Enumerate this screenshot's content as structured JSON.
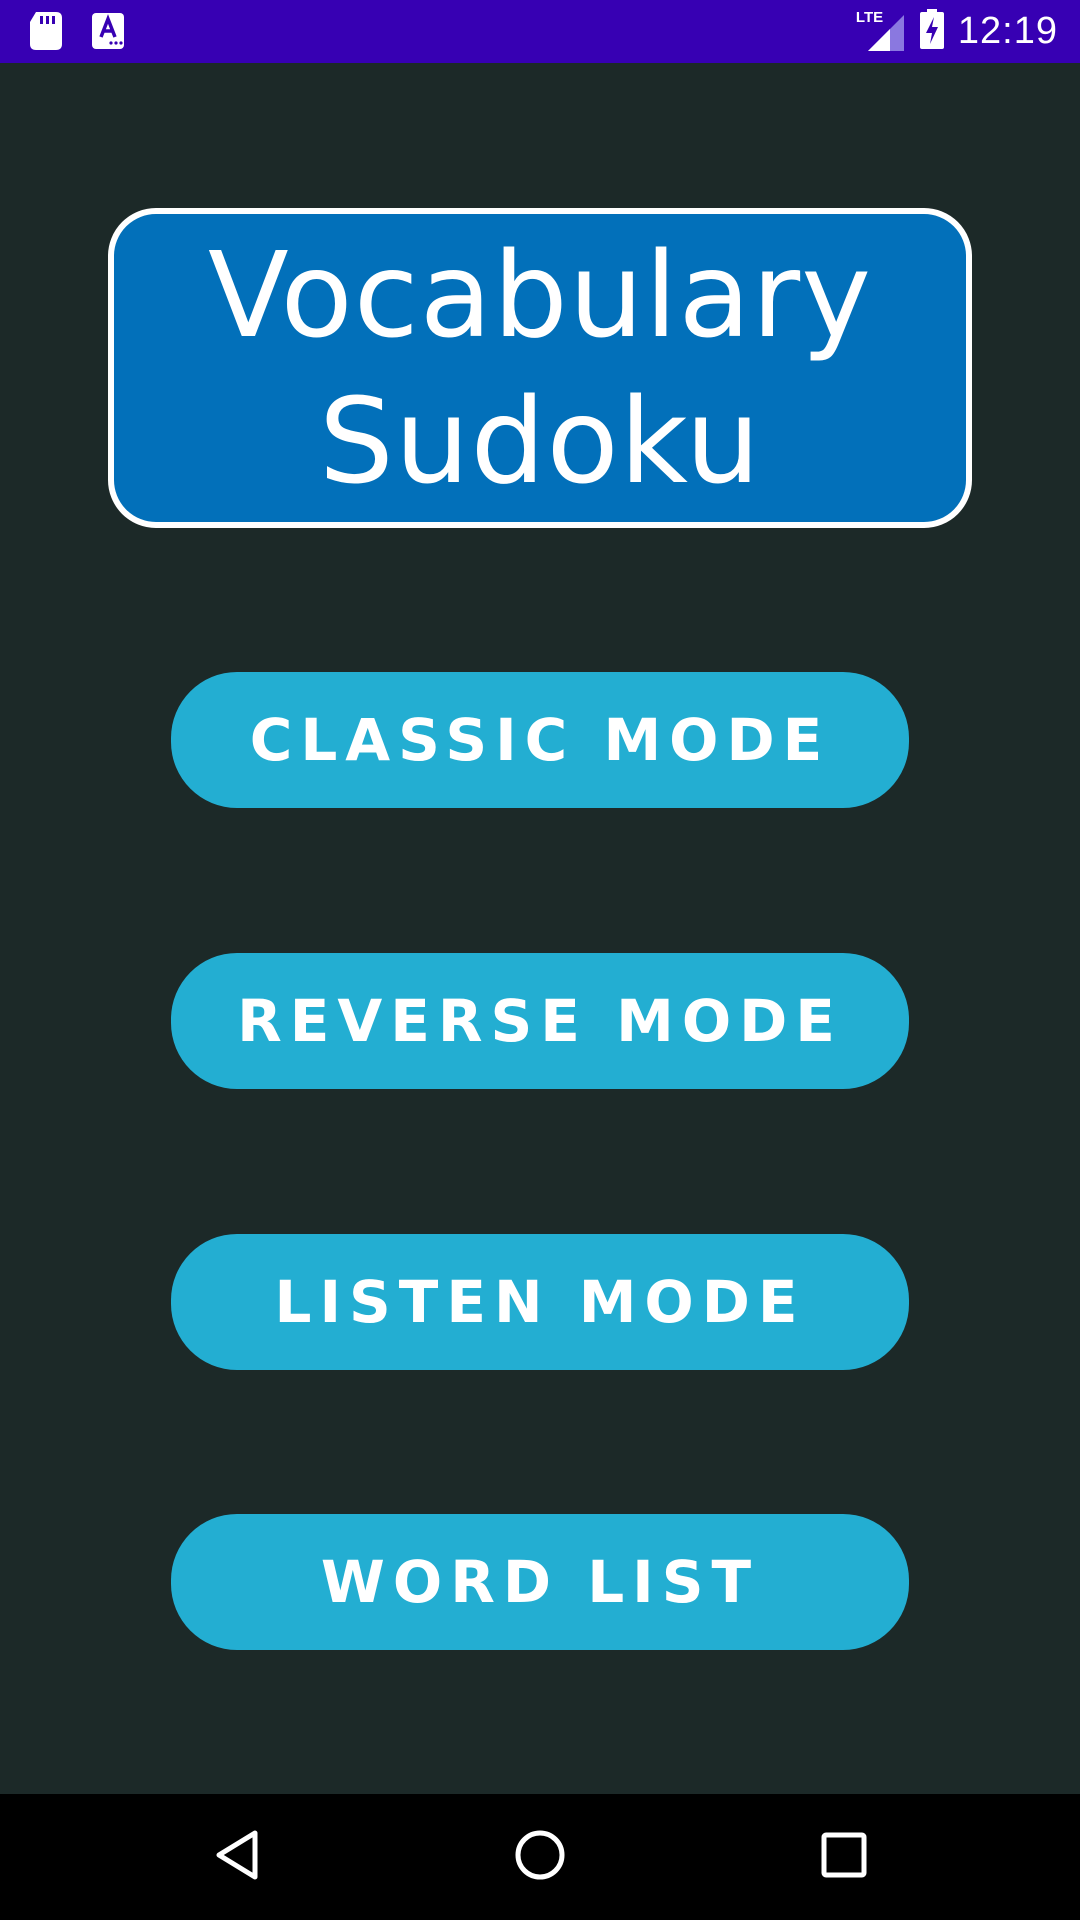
{
  "status_bar": {
    "time": "12:19",
    "network": "LTE",
    "left_icons": [
      "sd-card-icon",
      "keyboard-a-icon"
    ],
    "right_icons": [
      "lte-signal-icon",
      "battery-charging-icon"
    ],
    "background": "#3700b3"
  },
  "title": {
    "line1": "Vocabulary",
    "line2": "Sudoku",
    "background": "#0270ba",
    "border": "#ffffff"
  },
  "menu": {
    "classic_label": "CLASSIC MODE",
    "reverse_label": "REVERSE MODE",
    "listen_label": "LISTEN MODE",
    "word_list_label": "WORD LIST",
    "button_color": "#23aed2"
  },
  "nav_bar": {
    "icons": [
      "back-icon",
      "home-icon",
      "recents-icon"
    ],
    "background": "#000000"
  },
  "colors": {
    "screen_background": "#1c2928",
    "text": "#ffffff"
  }
}
